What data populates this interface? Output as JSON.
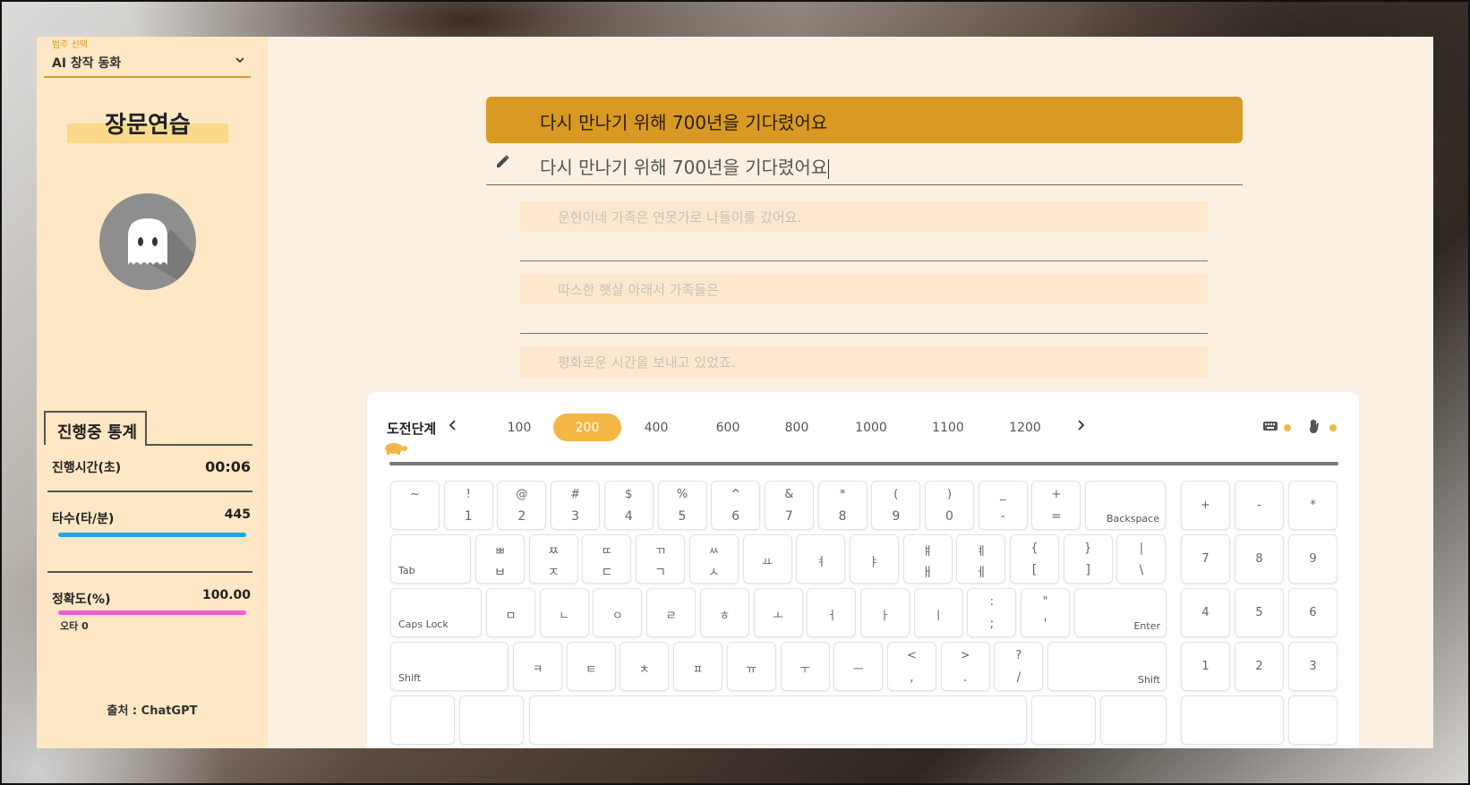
{
  "sidebar": {
    "category_label": "범주 선택",
    "category_value": "AI 창작 동화",
    "title": "장문연습",
    "stats_tab": "진행중 통계",
    "stats": {
      "time_label": "진행시간(초)",
      "time_value": "00:06",
      "speed_label": "타수(타/분)",
      "speed_value": "445",
      "accuracy_label": "정확도(%)",
      "accuracy_value": "100.00",
      "typo_text": "오타 0"
    },
    "source": "출처 : ChatGPT",
    "colors": {
      "speed_bar": "#1ea7e8",
      "accuracy_bar": "#f05fd8",
      "accent": "#d89a2a"
    }
  },
  "practice": {
    "current_sentence": "다시 만나기 위해 700년을 기다렸어요",
    "typed_text": "다시 만나기 위해 700년을 기다렸어요",
    "next_sentences": [
      "운현이네 가족은 연못가로 나들이를 갔어요.",
      "따스한 햇살 아래서 가족들은",
      "평화로운 시간을 보내고 있었죠."
    ]
  },
  "stage": {
    "label": "도전단계",
    "levels": [
      "100",
      "200",
      "400",
      "600",
      "800",
      "1000",
      "1100",
      "1200"
    ],
    "active": "200"
  },
  "keyboard": {
    "row1": [
      {
        "top": "~",
        "bottom": ""
      },
      {
        "top": "!",
        "bottom": "1"
      },
      {
        "top": "@",
        "bottom": "2"
      },
      {
        "top": "#",
        "bottom": "3"
      },
      {
        "top": "$",
        "bottom": "4"
      },
      {
        "top": "%",
        "bottom": "5"
      },
      {
        "top": "^",
        "bottom": "6"
      },
      {
        "top": "&",
        "bottom": "7"
      },
      {
        "top": "*",
        "bottom": "8"
      },
      {
        "top": "(",
        "bottom": "9"
      },
      {
        "top": ")",
        "bottom": "0"
      },
      {
        "top": "_",
        "bottom": "-"
      },
      {
        "top": "+",
        "bottom": "="
      }
    ],
    "backspace": "Backspace",
    "tab": "Tab",
    "row2": [
      {
        "top": "ㅃ",
        "bottom": "ㅂ"
      },
      {
        "top": "ㅉ",
        "bottom": "ㅈ"
      },
      {
        "top": "ㄸ",
        "bottom": "ㄷ"
      },
      {
        "top": "ㄲ",
        "bottom": "ㄱ"
      },
      {
        "top": "ㅆ",
        "bottom": "ㅅ"
      },
      {
        "top": "",
        "bottom": "ㅛ",
        "single": true
      },
      {
        "top": "",
        "bottom": "ㅕ",
        "single": true
      },
      {
        "top": "",
        "bottom": "ㅑ",
        "single": true
      },
      {
        "top": "ㅒ",
        "bottom": "ㅐ"
      },
      {
        "top": "ㅖ",
        "bottom": "ㅔ"
      },
      {
        "top": "{",
        "bottom": "["
      },
      {
        "top": "}",
        "bottom": "]"
      },
      {
        "top": "|",
        "bottom": "\\"
      }
    ],
    "caps": "Caps Lock",
    "row3": [
      {
        "c": "ㅁ"
      },
      {
        "c": "ㄴ"
      },
      {
        "c": "ㅇ"
      },
      {
        "c": "ㄹ"
      },
      {
        "c": "ㅎ"
      },
      {
        "c": "ㅗ"
      },
      {
        "c": "ㅓ"
      },
      {
        "c": "ㅏ"
      },
      {
        "c": "ㅣ"
      },
      {
        "top": ":",
        "bottom": ";"
      },
      {
        "top": "\"",
        "bottom": "'"
      }
    ],
    "enter": "Enter",
    "shift": "Shift",
    "row4": [
      {
        "c": "ㅋ"
      },
      {
        "c": "ㅌ"
      },
      {
        "c": "ㅊ"
      },
      {
        "c": "ㅍ"
      },
      {
        "c": "ㅠ"
      },
      {
        "c": "ㅜ"
      },
      {
        "c": "ㅡ"
      },
      {
        "top": "<",
        "bottom": ","
      },
      {
        "top": ">",
        "bottom": "."
      },
      {
        "top": "?",
        "bottom": "/"
      }
    ],
    "numpad": [
      "+",
      "-",
      "*",
      "7",
      "8",
      "9",
      "4",
      "5",
      "6",
      "1",
      "2",
      "3"
    ]
  }
}
